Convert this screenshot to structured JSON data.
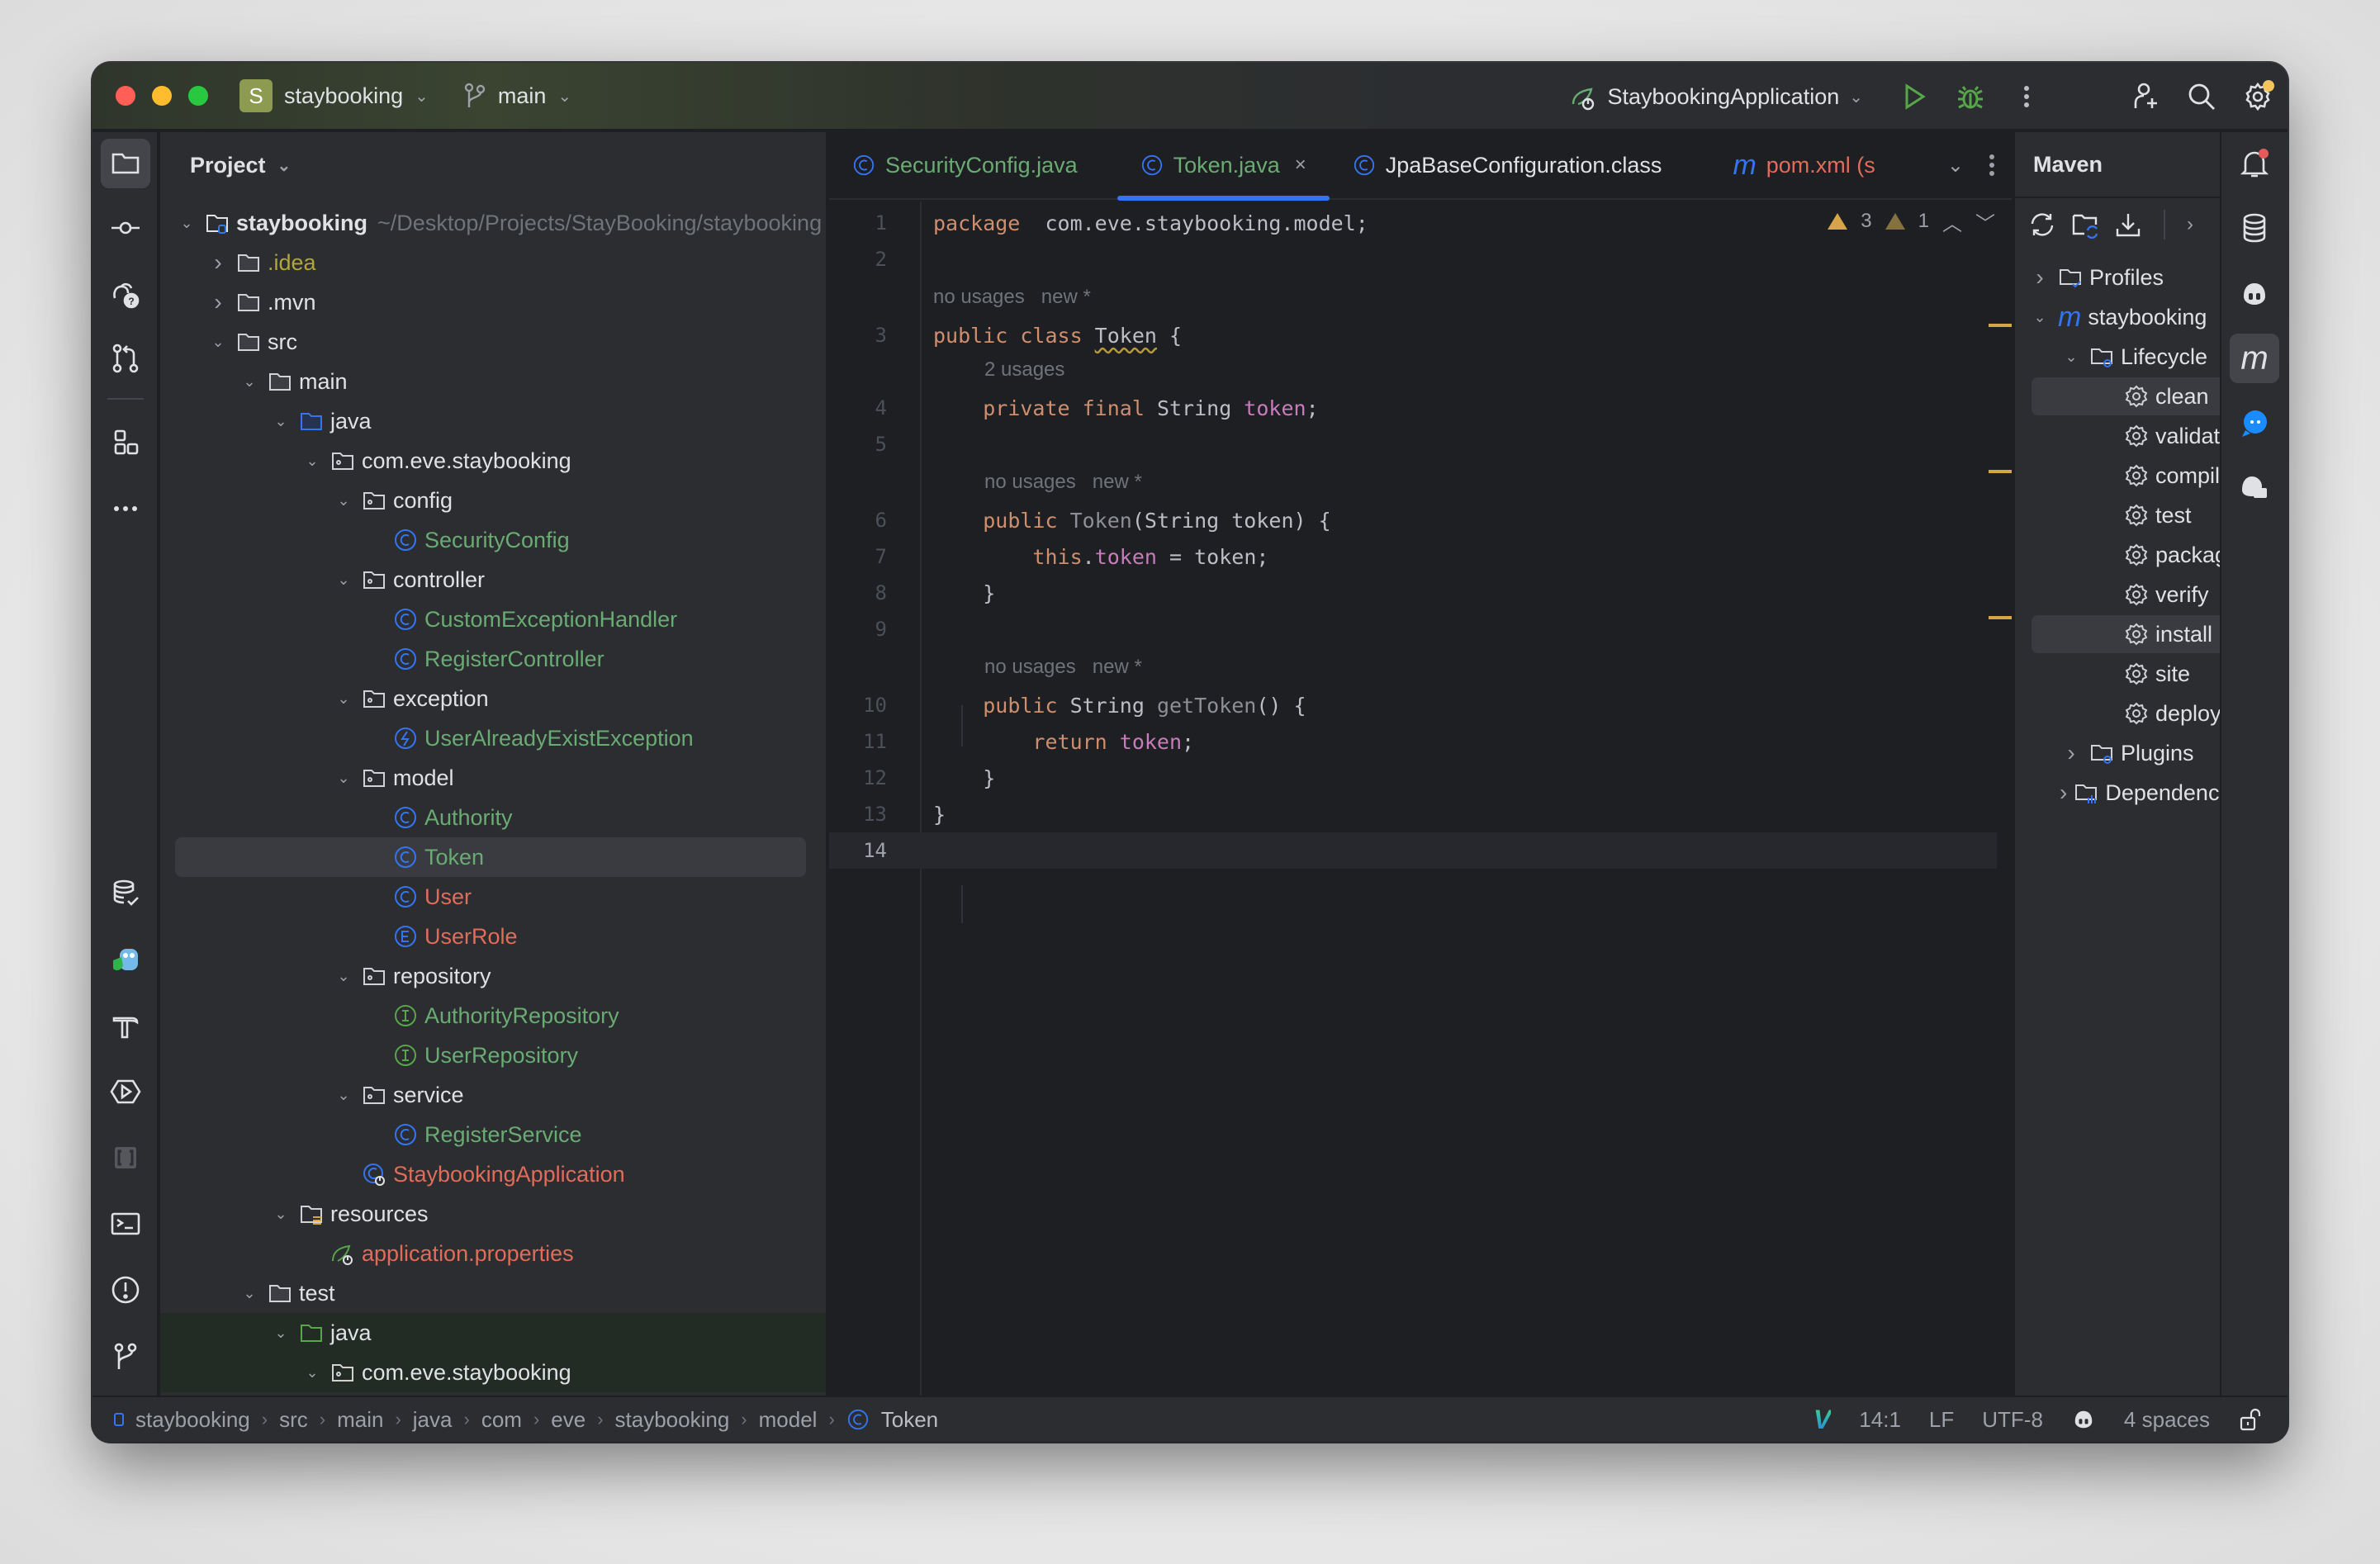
{
  "titlebar": {
    "project_initial": "S",
    "project_name": "staybooking",
    "branch": "main",
    "run_config": "StaybookingApplication",
    "accent_badge_color": "#8c9b4f"
  },
  "left_stripe": {
    "top_icons": [
      "folder-icon",
      "commit-icon",
      "ai-help-icon",
      "pull-requests-icon",
      "structure-icon",
      "more-icon"
    ],
    "bottom_icons": [
      "database-check-icon",
      "gopher-icon",
      "build-hammer-icon",
      "services-icon",
      "bracket-icon",
      "terminal-icon",
      "problems-icon",
      "git-icon",
      "run-icon"
    ]
  },
  "project_panel": {
    "title": "Project",
    "root": {
      "name": "staybooking",
      "path": "~/Desktop/Projects/StayBooking/staybooking"
    },
    "tree": [
      {
        "label": ".idea",
        "depth": 1,
        "arrow": "right",
        "icon": "folder",
        "color": "olive"
      },
      {
        "label": ".mvn",
        "depth": 1,
        "arrow": "right",
        "icon": "folder",
        "color": "default"
      },
      {
        "label": "src",
        "depth": 1,
        "arrow": "down",
        "icon": "folder",
        "color": "default"
      },
      {
        "label": "main",
        "depth": 2,
        "arrow": "down",
        "icon": "folder",
        "color": "default"
      },
      {
        "label": "java",
        "depth": 3,
        "arrow": "down",
        "icon": "source-folder",
        "color": "default"
      },
      {
        "label": "com.eve.staybooking",
        "depth": 4,
        "arrow": "down",
        "icon": "package",
        "color": "default"
      },
      {
        "label": "config",
        "depth": 5,
        "arrow": "down",
        "icon": "package",
        "color": "default"
      },
      {
        "label": "SecurityConfig",
        "depth": 6,
        "arrow": "",
        "icon": "class",
        "color": "green"
      },
      {
        "label": "controller",
        "depth": 5,
        "arrow": "down",
        "icon": "package",
        "color": "default"
      },
      {
        "label": "CustomExceptionHandler",
        "depth": 6,
        "arrow": "",
        "icon": "class",
        "color": "green"
      },
      {
        "label": "RegisterController",
        "depth": 6,
        "arrow": "",
        "icon": "class",
        "color": "green"
      },
      {
        "label": "exception",
        "depth": 5,
        "arrow": "down",
        "icon": "package",
        "color": "default"
      },
      {
        "label": "UserAlreadyExistException",
        "depth": 6,
        "arrow": "",
        "icon": "exception",
        "color": "green"
      },
      {
        "label": "model",
        "depth": 5,
        "arrow": "down",
        "icon": "package",
        "color": "default"
      },
      {
        "label": "Authority",
        "depth": 6,
        "arrow": "",
        "icon": "class",
        "color": "green"
      },
      {
        "label": "Token",
        "depth": 6,
        "arrow": "",
        "icon": "class",
        "color": "green",
        "selected": true
      },
      {
        "label": "User",
        "depth": 6,
        "arrow": "",
        "icon": "class",
        "color": "red"
      },
      {
        "label": "UserRole",
        "depth": 6,
        "arrow": "",
        "icon": "enum",
        "color": "red"
      },
      {
        "label": "repository",
        "depth": 5,
        "arrow": "down",
        "icon": "package",
        "color": "default"
      },
      {
        "label": "AuthorityRepository",
        "depth": 6,
        "arrow": "",
        "icon": "interface",
        "color": "green"
      },
      {
        "label": "UserRepository",
        "depth": 6,
        "arrow": "",
        "icon": "interface",
        "color": "green"
      },
      {
        "label": "service",
        "depth": 5,
        "arrow": "down",
        "icon": "package",
        "color": "default"
      },
      {
        "label": "RegisterService",
        "depth": 6,
        "arrow": "",
        "icon": "class",
        "color": "green"
      },
      {
        "label": "StaybookingApplication",
        "depth": 5,
        "arrow": "",
        "icon": "spring-class",
        "color": "red"
      },
      {
        "label": "resources",
        "depth": 3,
        "arrow": "down",
        "icon": "resources-folder",
        "color": "default"
      },
      {
        "label": "application.properties",
        "depth": 4,
        "arrow": "",
        "icon": "spring-properties",
        "color": "red"
      },
      {
        "label": "test",
        "depth": 2,
        "arrow": "down",
        "icon": "folder",
        "color": "default"
      },
      {
        "label": "java",
        "depth": 3,
        "arrow": "down",
        "icon": "test-folder",
        "color": "default",
        "test": true
      },
      {
        "label": "com.eve.staybooking",
        "depth": 4,
        "arrow": "down",
        "icon": "package",
        "color": "default",
        "test": true
      }
    ]
  },
  "editor": {
    "tabs": [
      {
        "label": "SecurityConfig.java",
        "icon": "class",
        "color": "green",
        "active": false
      },
      {
        "label": "Token.java",
        "icon": "class",
        "color": "green",
        "active": true,
        "close": "×"
      },
      {
        "label": "JpaBaseConfiguration.class",
        "icon": "class",
        "color": "default",
        "active": false
      },
      {
        "label": "pom.xml (s",
        "icon": "maven",
        "color": "red",
        "active": false
      }
    ],
    "inspections": {
      "warnings": "3",
      "weak_warnings": "1"
    },
    "hints": {
      "class": "no usages   new *",
      "field": "2 usages",
      "ctor": "no usages   new *",
      "getter": "no usages   new *"
    },
    "lines": [
      {
        "n": "1",
        "tokens": [
          [
            "kw",
            "package"
          ],
          [
            "",
            "  com.eve.staybooking.model;"
          ]
        ]
      },
      {
        "n": "2",
        "tokens": []
      },
      {
        "n": "3",
        "tokens": [
          [
            "kw",
            "public class "
          ],
          [
            "squig",
            "Token"
          ],
          [
            "",
            " {"
          ]
        ]
      },
      {
        "n": "4",
        "tokens": [
          [
            "",
            "    "
          ],
          [
            "kw",
            "private final "
          ],
          [
            "",
            "String "
          ],
          [
            "fld",
            "token"
          ],
          [
            "",
            ";"
          ]
        ]
      },
      {
        "n": "5",
        "tokens": []
      },
      {
        "n": "6",
        "tokens": [
          [
            "",
            "    "
          ],
          [
            "kw",
            "public "
          ],
          [
            "dim",
            "Token"
          ],
          [
            "",
            "(String token) {"
          ]
        ]
      },
      {
        "n": "7",
        "tokens": [
          [
            "",
            "        "
          ],
          [
            "kw",
            "this"
          ],
          [
            "",
            "."
          ],
          [
            "fld",
            "token"
          ],
          [
            "",
            " = token;"
          ]
        ]
      },
      {
        "n": "8",
        "tokens": [
          [
            "",
            "    }"
          ]
        ]
      },
      {
        "n": "9",
        "tokens": []
      },
      {
        "n": "10",
        "tokens": [
          [
            "",
            "    "
          ],
          [
            "kw",
            "public "
          ],
          [
            "",
            "String "
          ],
          [
            "dim",
            "getToken"
          ],
          [
            "",
            "() {"
          ]
        ]
      },
      {
        "n": "11",
        "tokens": [
          [
            "",
            "        "
          ],
          [
            "kw",
            "return "
          ],
          [
            "fld",
            "token"
          ],
          [
            "",
            ";"
          ]
        ]
      },
      {
        "n": "12",
        "tokens": [
          [
            "",
            "    }"
          ]
        ]
      },
      {
        "n": "13",
        "tokens": [
          [
            "",
            "}"
          ]
        ]
      },
      {
        "n": "14",
        "tokens": [],
        "current": true
      }
    ]
  },
  "maven": {
    "title": "Maven",
    "items": [
      {
        "label": "Profiles",
        "depth": 0,
        "arrow": "right",
        "icon": "profiles-folder"
      },
      {
        "label": "staybooking",
        "depth": 0,
        "arrow": "down",
        "icon": "maven-m"
      },
      {
        "label": "Lifecycle",
        "depth": 1,
        "arrow": "down",
        "icon": "lifecycle-folder"
      },
      {
        "label": "clean",
        "depth": 2,
        "arrow": "",
        "icon": "gear",
        "selected": true
      },
      {
        "label": "validate",
        "depth": 2,
        "arrow": "",
        "icon": "gear"
      },
      {
        "label": "compile",
        "depth": 2,
        "arrow": "",
        "icon": "gear"
      },
      {
        "label": "test",
        "depth": 2,
        "arrow": "",
        "icon": "gear"
      },
      {
        "label": "package",
        "depth": 2,
        "arrow": "",
        "icon": "gear"
      },
      {
        "label": "verify",
        "depth": 2,
        "arrow": "",
        "icon": "gear"
      },
      {
        "label": "install",
        "depth": 2,
        "arrow": "",
        "icon": "gear",
        "selected": true
      },
      {
        "label": "site",
        "depth": 2,
        "arrow": "",
        "icon": "gear"
      },
      {
        "label": "deploy",
        "depth": 2,
        "arrow": "",
        "icon": "gear"
      },
      {
        "label": "Plugins",
        "depth": 1,
        "arrow": "right",
        "icon": "plugins-folder"
      },
      {
        "label": "Dependencies",
        "depth": 1,
        "arrow": "right",
        "icon": "dependencies-folder"
      }
    ]
  },
  "right_stripe": {
    "icons": [
      "notifications-icon",
      "database-icon",
      "copilot-icon",
      "maven-icon",
      "chat-icon",
      "copilot-chat-icon"
    ],
    "notification_dot_color": "#e55b5b"
  },
  "statusbar": {
    "breadcrumbs": [
      "staybooking",
      "src",
      "main",
      "java",
      "com",
      "eve",
      "staybooking",
      "model",
      "Token"
    ],
    "cursor": "14:1",
    "line_separator": "LF",
    "encoding": "UTF-8",
    "indent": "4 spaces"
  }
}
